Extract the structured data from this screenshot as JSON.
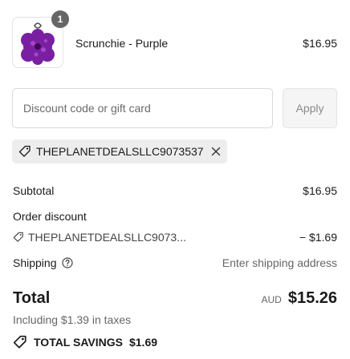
{
  "line_item": {
    "quantity": "1",
    "name": "Scrunchie - Purple",
    "price": "$16.95",
    "image_icon": "scrunchie-image"
  },
  "discount_form": {
    "placeholder": "Discount code or gift card",
    "value": "",
    "apply_label": "Apply"
  },
  "applied_code": {
    "code": "THEPLANETDEALSLLC9073537",
    "icon": "tag-icon",
    "remove_icon": "close-icon"
  },
  "summary": {
    "subtotal_label": "Subtotal",
    "subtotal_value": "$16.95",
    "order_discount_label": "Order discount",
    "order_discount_code": "THEPLANETDEALSLLC9073...",
    "order_discount_value": "− $1.69",
    "shipping_label": "Shipping",
    "shipping_value": "Enter shipping address",
    "total_label": "Total",
    "currency": "AUD",
    "total_value": "$15.26",
    "taxes_note": "Including $1.39 in taxes",
    "savings_label": "TOTAL SAVINGS",
    "savings_value": "$1.69"
  },
  "colors": {
    "product": "#7a1fa2",
    "chip_bg": "#ededed",
    "badge_bg": "#666666"
  }
}
